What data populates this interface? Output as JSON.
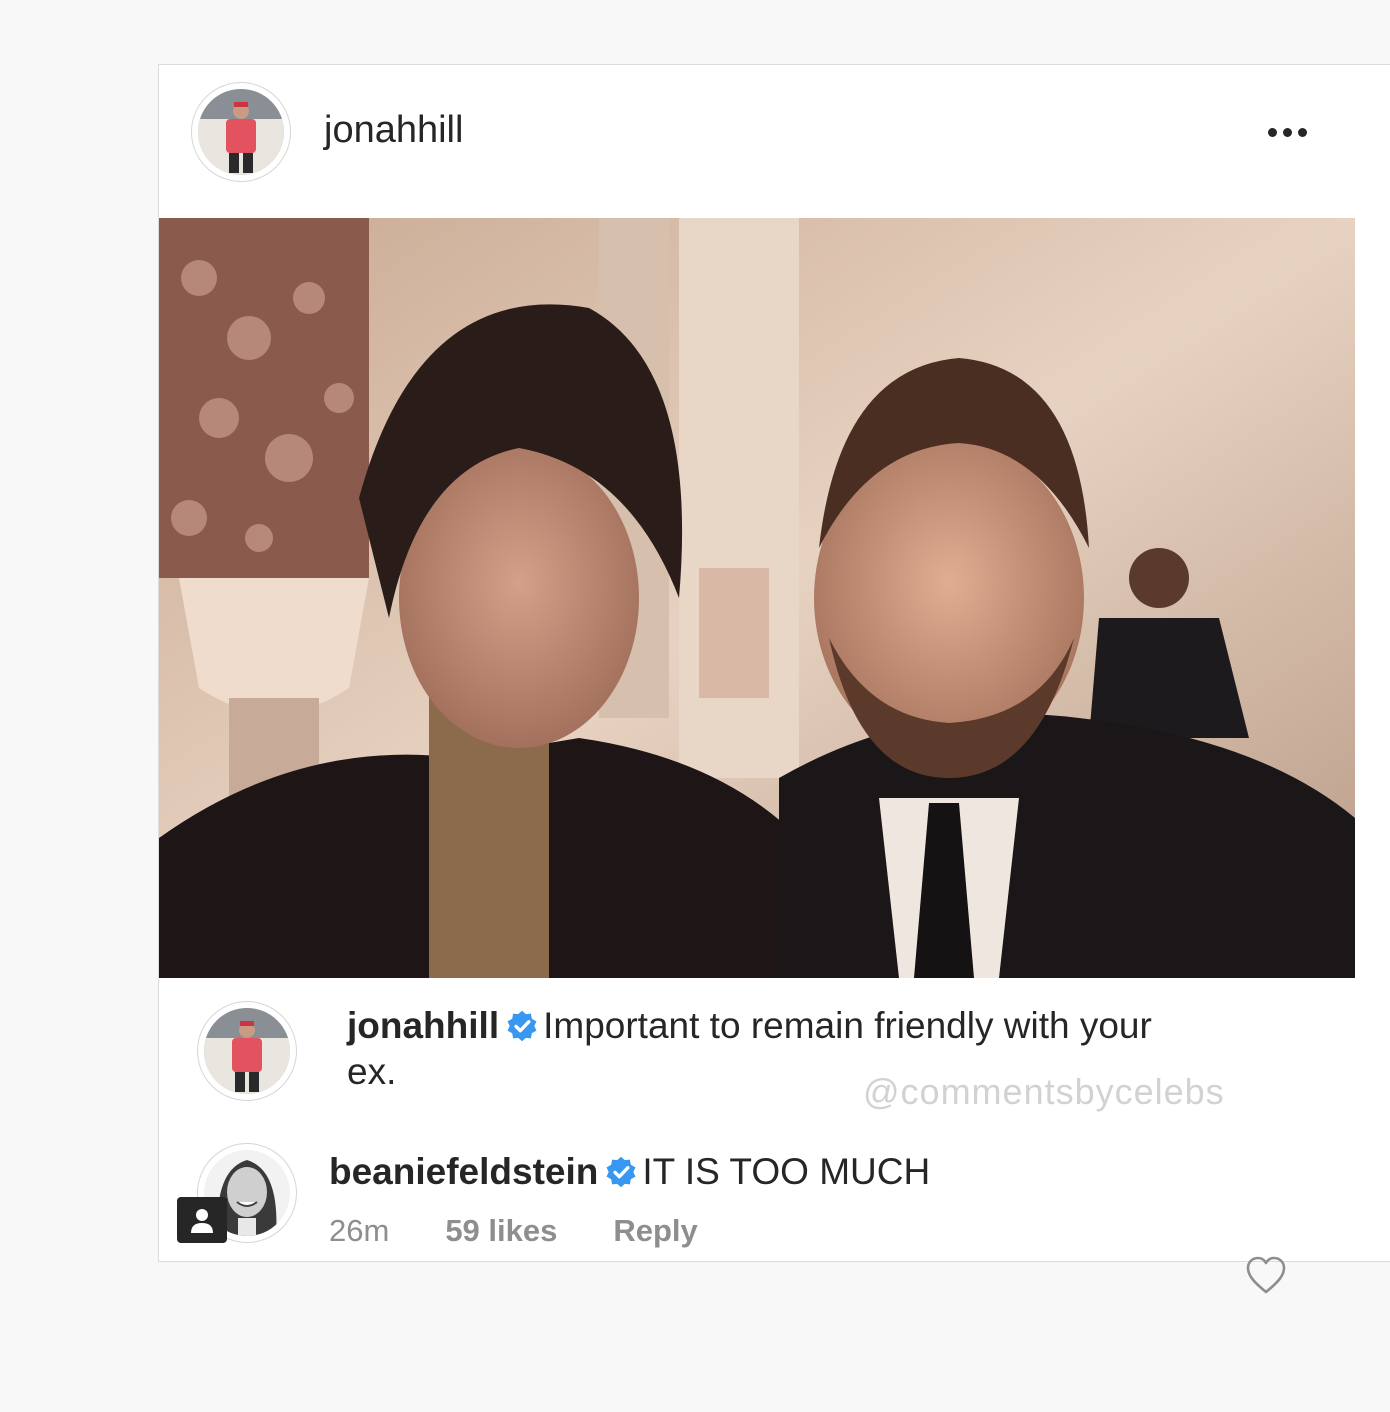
{
  "post": {
    "username": "jonahhill",
    "more_icon": "more-dots-icon"
  },
  "caption": {
    "username": "jonahhill",
    "verified_icon": "verified-badge-icon",
    "text": "Important to remain friendly with your ex."
  },
  "watermark": "@commentsbycelebs",
  "comment": {
    "username": "beaniefeldstein",
    "verified_icon": "verified-badge-icon",
    "text": "IT IS TOO MUCH",
    "time": "26m",
    "likes": "59 likes",
    "reply": "Reply",
    "like_icon": "heart-outline-icon"
  },
  "colors": {
    "verified": "#3897f0",
    "text": "#262626",
    "muted": "#8e8e8e",
    "border": "#dbdbdb"
  }
}
